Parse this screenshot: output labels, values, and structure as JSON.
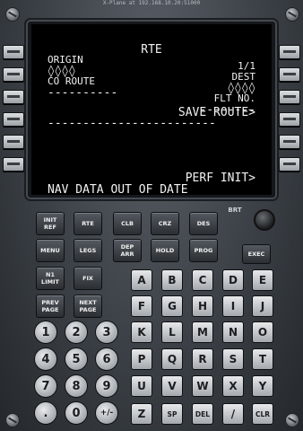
{
  "window_title": "X-Plane at 192.168.10.20:51000",
  "cdu": {
    "title": "RTE",
    "page": "1/1",
    "origin_label": "ORIGIN",
    "origin_value": "◊◊◊◊",
    "dest_label": "DEST",
    "dest_value": "◊◊◊◊",
    "co_route_label": "CO ROUTE",
    "flt_no_label": "FLT NO.",
    "co_route_value": "----------",
    "flt_no_value": "--------",
    "save_route": "SAVE ROUTE>",
    "dash_line": "------------------------",
    "perf_init": "PERF INIT>",
    "scratchpad": "NAV DATA OUT OF DATE"
  },
  "brt_label": "BRT",
  "exec_label": "EXEC",
  "function_keys": [
    {
      "name": "init-ref-key",
      "label": "INIT\nREF"
    },
    {
      "name": "rte-key",
      "label": "RTE"
    },
    {
      "name": "clb-key",
      "label": "CLB"
    },
    {
      "name": "crz-key",
      "label": "CRZ"
    },
    {
      "name": "des-key",
      "label": "DES"
    },
    {
      "name": "menu-key",
      "label": "MENU"
    },
    {
      "name": "legs-key",
      "label": "LEGS"
    },
    {
      "name": "dep-arr-key",
      "label": "DEP\nARR"
    },
    {
      "name": "hold-key",
      "label": "HOLD"
    },
    {
      "name": "prog-key",
      "label": "PROG"
    },
    {
      "name": "n1-limit-key",
      "label": "N1\nLIMIT"
    },
    {
      "name": "fix-key",
      "label": "FIX"
    },
    {
      "name": "prev-page-key",
      "label": "PREV\nPAGE"
    },
    {
      "name": "next-page-key",
      "label": "NEXT\nPAGE"
    }
  ],
  "alpha_keys": [
    "A",
    "B",
    "C",
    "D",
    "E",
    "F",
    "G",
    "H",
    "I",
    "J",
    "K",
    "L",
    "M",
    "N",
    "O",
    "P",
    "Q",
    "R",
    "S",
    "T",
    "U",
    "V",
    "W",
    "X",
    "Y",
    "Z",
    "SP",
    "DEL",
    "/",
    "CLR"
  ],
  "num_keys": [
    "1",
    "2",
    "3",
    "4",
    "5",
    "6",
    "7",
    "8",
    "9",
    ".",
    "0",
    "+/-"
  ]
}
